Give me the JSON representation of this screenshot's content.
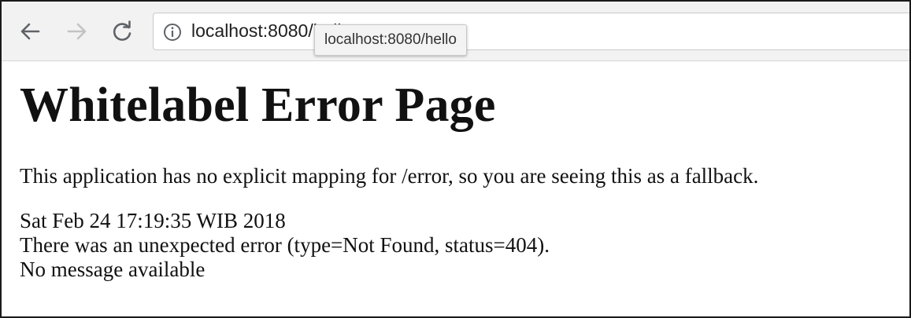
{
  "browser": {
    "address_bar": {
      "text": "localhost:8080/hello"
    },
    "tooltip": {
      "text": "localhost:8080/hello"
    },
    "icons": {
      "back": "arrow-left-icon",
      "forward": "arrow-right-icon",
      "reload": "reload-icon",
      "info": "info-icon"
    }
  },
  "page": {
    "title": "Whitelabel Error Page",
    "description": "This application has no explicit mapping for /error, so you are seeing this as a fallback.",
    "timestamp": "Sat Feb 24 17:19:35 WIB 2018",
    "error_line": "There was an unexpected error (type=Not Found, status=404).",
    "message": "No message available"
  }
}
